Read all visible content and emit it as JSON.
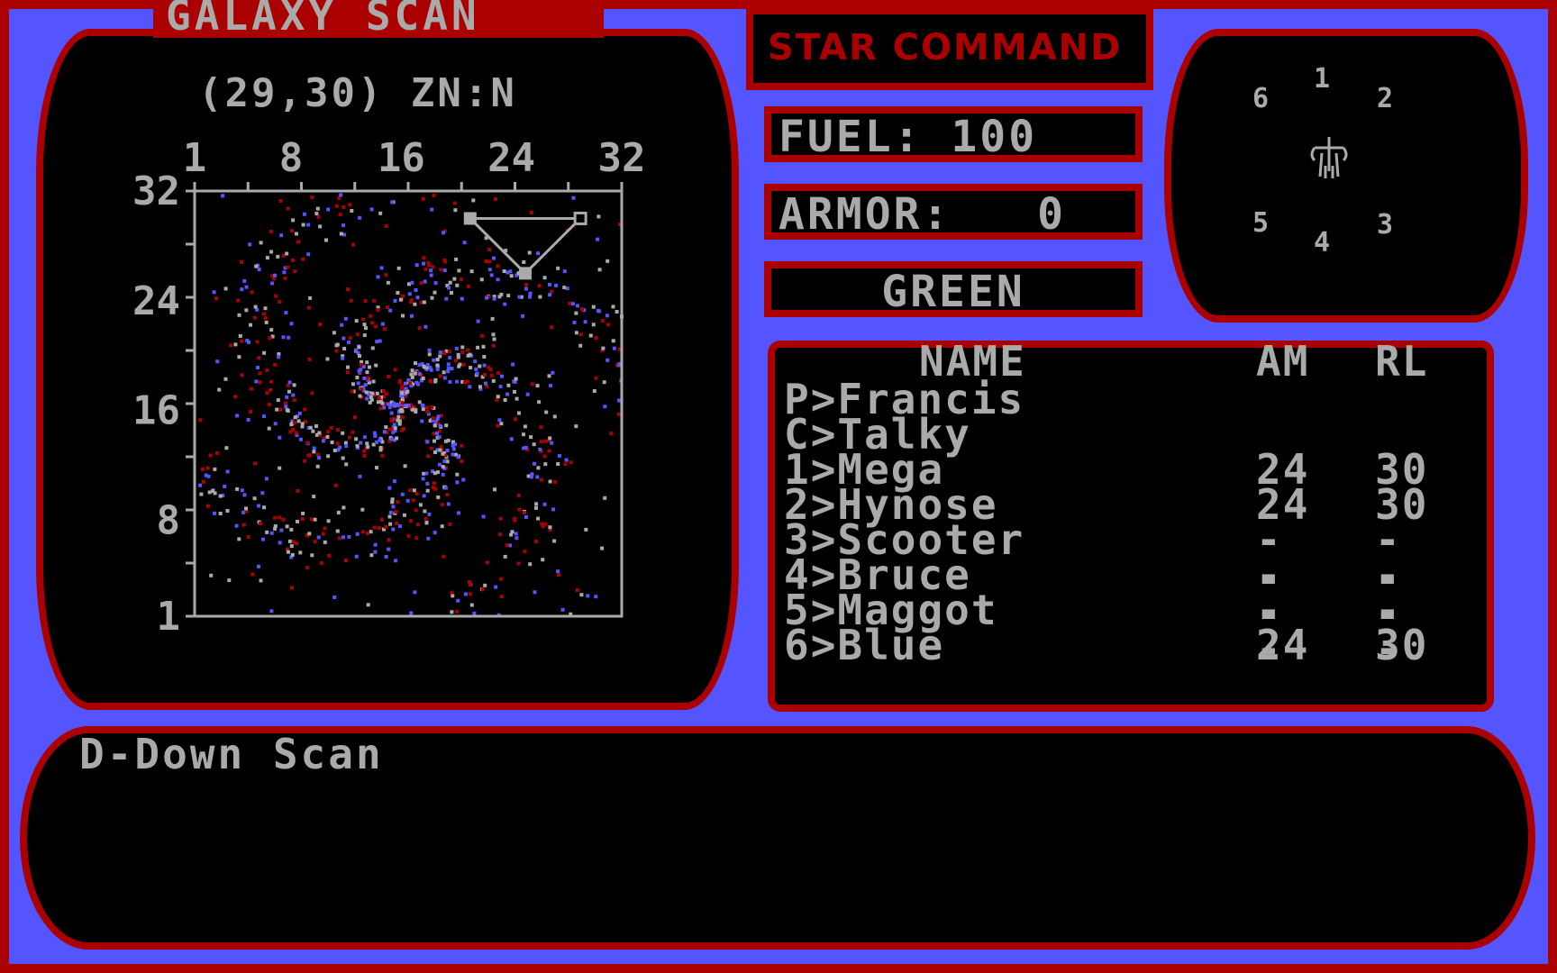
{
  "palette": {
    "border": "#AA0000",
    "background": "#5555FF",
    "panel": "#000000",
    "text": "#AAAAAA",
    "star_red": "#AA0000",
    "star_blue": "#5555FF",
    "star_gray": "#AAAAAA"
  },
  "scan": {
    "title": "GALAXY SCAN",
    "coords": "(29,30) ZN:N"
  },
  "chart_data": {
    "type": "scatter",
    "title": "GALAXY SCAN",
    "x_ticks": [
      "1",
      "8",
      "16",
      "24",
      "32"
    ],
    "y_ticks": [
      "32",
      "24",
      "16",
      "8",
      "1"
    ],
    "xlim": [
      1,
      32
    ],
    "ylim": [
      1,
      32
    ],
    "description": "spiral galaxy star field with red, blue and gray stars",
    "route": [
      {
        "x": 21,
        "y": 30,
        "marker": "filled-square"
      },
      {
        "x": 29,
        "y": 30,
        "marker": "hollow-square"
      },
      {
        "x": 25,
        "y": 26,
        "marker": "filled-square"
      }
    ]
  },
  "header": {
    "title": "STAR COMMAND"
  },
  "stats": {
    "fuel": "FUEL: 100",
    "armor": "ARMOR:   0",
    "condition": "GREEN"
  },
  "compass": {
    "positions": [
      "1",
      "2",
      "3",
      "4",
      "5",
      "6"
    ],
    "center_icon": "ship-icon"
  },
  "crew": {
    "headers": {
      "name": "NAME",
      "am": "AM",
      "rl": "RL"
    },
    "rows": [
      {
        "name": "P>Francis",
        "am": "",
        "rl": ""
      },
      {
        "name": "C>Talky",
        "am": "",
        "rl": ""
      },
      {
        "name": "1>Mega",
        "am": "24",
        "rl": "30"
      },
      {
        "name": "2>Hynose",
        "am": "24",
        "rl": "30"
      },
      {
        "name": "3>Scooter",
        "am": "--",
        "rl": "--"
      },
      {
        "name": "4>Bruce",
        "am": "--",
        "rl": "--"
      },
      {
        "name": "5>Maggot",
        "am": "--",
        "rl": "--"
      },
      {
        "name": "6>Blue",
        "am": "24",
        "rl": "30"
      }
    ]
  },
  "message": {
    "text": "D-Down Scan"
  }
}
